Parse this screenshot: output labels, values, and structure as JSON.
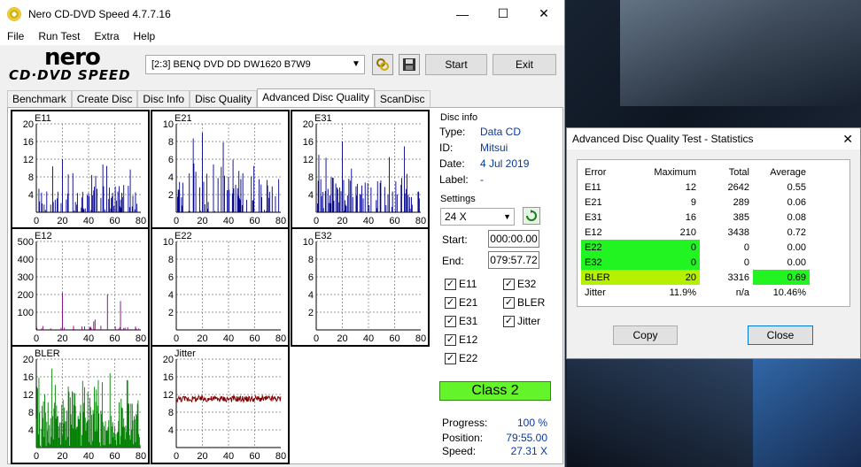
{
  "window": {
    "title": "Nero CD-DVD Speed 4.7.7.16",
    "min": "—",
    "max": "☐",
    "close": "✕"
  },
  "menu": [
    "File",
    "Run Test",
    "Extra",
    "Help"
  ],
  "logo": {
    "top": "nero",
    "bottom": "CD·DVD SPEED"
  },
  "toolbar": {
    "drive": "[2:3]   BENQ DVD DD DW1620 B7W9",
    "start_label": "Start",
    "exit_label": "Exit",
    "refresh_icon": "chain-icon",
    "save_icon": "floppy-icon"
  },
  "tabs": [
    "Benchmark",
    "Create Disc",
    "Disc Info",
    "Disc Quality",
    "Advanced Disc Quality",
    "ScanDisc"
  ],
  "active_tab": 4,
  "disc_info": {
    "title": "Disc info",
    "type_label": "Type:",
    "type": "Data CD",
    "id_label": "ID:",
    "id": "Mitsui",
    "date_label": "Date:",
    "date": "4 Jul 2019",
    "label_label": "Label:",
    "label": "-"
  },
  "settings": {
    "title": "Settings",
    "speed": "24 X",
    "start_label": "Start:",
    "start": "000:00.00",
    "end_label": "End:",
    "end": "079:57.72",
    "checks": [
      {
        "name": "E11",
        "checked": true
      },
      {
        "name": "E32",
        "checked": true
      },
      {
        "name": "E21",
        "checked": true
      },
      {
        "name": "BLER",
        "checked": true
      },
      {
        "name": "E31",
        "checked": true
      },
      {
        "name": "Jitter",
        "checked": true
      },
      {
        "name": "E12",
        "checked": true
      },
      {
        "name": "E22",
        "checked": true
      }
    ]
  },
  "class_label": "Class 2",
  "progress": {
    "progress_label": "Progress:",
    "progress": "100 %",
    "position_label": "Position:",
    "position": "79:55.00",
    "speed_label": "Speed:",
    "speed": "27.31 X"
  },
  "chart_data": [
    {
      "type": "bar",
      "title": "E11",
      "color": "#00008b",
      "xlim": [
        0,
        80
      ],
      "ylim": [
        0,
        20
      ],
      "yticks": [
        4,
        8,
        12,
        16,
        20
      ],
      "xticks": [
        0,
        20,
        40,
        60,
        80
      ],
      "max": 12
    },
    {
      "type": "bar",
      "title": "E21",
      "color": "#00008b",
      "xlim": [
        0,
        80
      ],
      "ylim": [
        0,
        10
      ],
      "yticks": [
        2,
        4,
        6,
        8,
        10
      ],
      "xticks": [
        0,
        20,
        40,
        60,
        80
      ],
      "max": 9
    },
    {
      "type": "bar",
      "title": "E31",
      "color": "#00008b",
      "xlim": [
        0,
        80
      ],
      "ylim": [
        0,
        20
      ],
      "yticks": [
        4,
        8,
        12,
        16,
        20
      ],
      "xticks": [
        0,
        20,
        40,
        60,
        80
      ],
      "max": 16
    },
    {
      "type": "bar",
      "title": "E12",
      "color": "#800080",
      "xlim": [
        0,
        80
      ],
      "ylim": [
        0,
        500
      ],
      "yticks": [
        100,
        200,
        300,
        400,
        500
      ],
      "xticks": [
        0,
        20,
        40,
        60,
        80
      ],
      "max": 210
    },
    {
      "type": "bar",
      "title": "E22",
      "color": "#00008b",
      "xlim": [
        0,
        80
      ],
      "ylim": [
        0,
        10
      ],
      "yticks": [
        2,
        4,
        6,
        8,
        10
      ],
      "xticks": [
        0,
        20,
        40,
        60,
        80
      ],
      "max": 0
    },
    {
      "type": "bar",
      "title": "E32",
      "color": "#00008b",
      "xlim": [
        0,
        80
      ],
      "ylim": [
        0,
        10
      ],
      "yticks": [
        2,
        4,
        6,
        8,
        10
      ],
      "xticks": [
        0,
        20,
        40,
        60,
        80
      ],
      "max": 0
    },
    {
      "type": "bar",
      "title": "BLER",
      "color": "#008000",
      "xlim": [
        0,
        80
      ],
      "ylim": [
        0,
        20
      ],
      "yticks": [
        4,
        8,
        12,
        16,
        20
      ],
      "xticks": [
        0,
        20,
        40,
        60,
        80
      ],
      "max": 20
    },
    {
      "type": "line",
      "title": "Jitter",
      "color": "#800000",
      "xlim": [
        0,
        80
      ],
      "ylim": [
        0,
        20
      ],
      "yticks": [
        4,
        8,
        12,
        16,
        20
      ],
      "xticks": [
        0,
        20,
        40,
        60,
        80
      ],
      "level": 11
    }
  ],
  "stats": {
    "title": "Advanced Disc Quality Test - Statistics",
    "headers": [
      "Error",
      "Maximum",
      "Total",
      "Average"
    ],
    "rows": [
      {
        "name": "E11",
        "max": "12",
        "total": "2642",
        "avg": "0.55"
      },
      {
        "name": "E21",
        "max": "9",
        "total": "289",
        "avg": "0.06"
      },
      {
        "name": "E31",
        "max": "16",
        "total": "385",
        "avg": "0.08"
      },
      {
        "name": "E12",
        "max": "210",
        "total": "3438",
        "avg": "0.72"
      },
      {
        "name": "E22",
        "max": "0",
        "total": "0",
        "avg": "0.00"
      },
      {
        "name": "E32",
        "max": "0",
        "total": "0",
        "avg": "0.00"
      },
      {
        "name": "BLER",
        "max": "20",
        "total": "3316",
        "avg": "0.69"
      },
      {
        "name": "Jitter",
        "max": "11.9%",
        "total": "n/a",
        "avg": "10.46%"
      }
    ],
    "copy_label": "Copy",
    "close_label": "Close"
  }
}
